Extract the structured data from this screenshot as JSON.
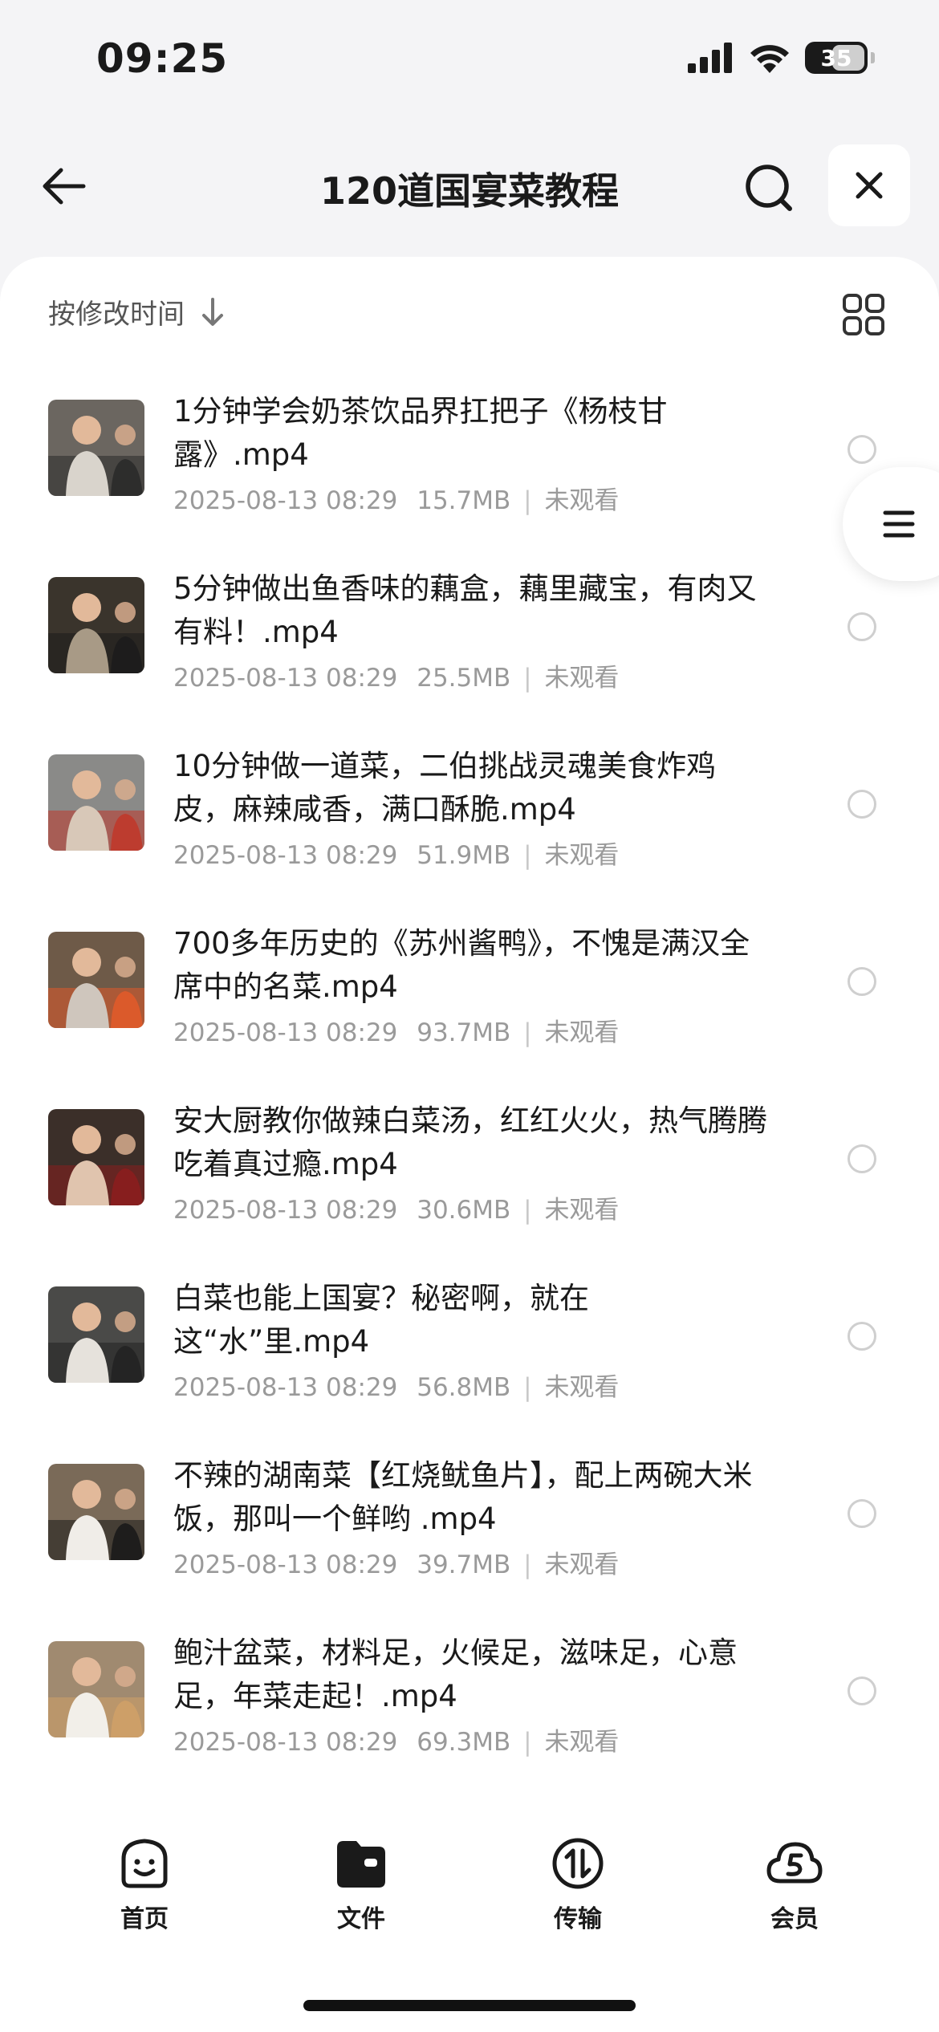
{
  "status_bar": {
    "time": "09:25",
    "battery": "35"
  },
  "nav": {
    "title": "120道国宴菜教程"
  },
  "sort": {
    "label": "按修改时间"
  },
  "files": [
    {
      "name": "1分钟学会奶茶饮品界扛把子《杨枝甘露》.mp4",
      "date": "2025-08-13 08:29",
      "size": "15.7MB",
      "status": "未观看",
      "thumb_colors": [
        "#6b6660",
        "#d9d4cc",
        "#2a2a2a"
      ]
    },
    {
      "name": "5分钟做出鱼香味的藕盒，藕里藏宝，有肉又有料！.mp4",
      "date": "2025-08-13 08:29",
      "size": "25.5MB",
      "status": "未观看",
      "thumb_colors": [
        "#3a342c",
        "#a89a86",
        "#1c1c1c"
      ]
    },
    {
      "name": "10分钟做一道菜，二伯挑战灵魂美食炸鸡皮，麻辣咸香，满口酥脆.mp4",
      "date": "2025-08-13 08:29",
      "size": "51.9MB",
      "status": "未观看",
      "thumb_colors": [
        "#8a8a88",
        "#d8c8b8",
        "#c0392b"
      ]
    },
    {
      "name": "700多年历史的《苏州酱鸭》，不愧是满汉全席中的名菜.mp4",
      "date": "2025-08-13 08:29",
      "size": "93.7MB",
      "status": "未观看",
      "thumb_colors": [
        "#6e5a48",
        "#cfc6bd",
        "#e05a2a"
      ]
    },
    {
      "name": "安大厨教你做辣白菜汤，红红火火，热气腾腾吃着真过瘾.mp4",
      "date": "2025-08-13 08:29",
      "size": "30.6MB",
      "status": "未观看",
      "thumb_colors": [
        "#3b2f29",
        "#e0c4ae",
        "#8b1e1e"
      ]
    },
    {
      "name": "白菜也能上国宴？秘密啊，就在这“水”里.mp4",
      "date": "2025-08-13 08:29",
      "size": "56.8MB",
      "status": "未观看",
      "thumb_colors": [
        "#4a4a48",
        "#e6e2dc",
        "#222"
      ]
    },
    {
      "name": "不辣的湖南菜【红烧鱿鱼片】，配上两碗大米饭，那叫一个鲜哟 .mp4",
      "date": "2025-08-13 08:29",
      "size": "39.7MB",
      "status": "未观看",
      "thumb_colors": [
        "#7a6a58",
        "#f0ede8",
        "#1a1a1a"
      ]
    },
    {
      "name": "鲍汁盆菜，材料足，火候足，滋味足，心意足，年菜走起！.mp4",
      "date": "2025-08-13 08:29",
      "size": "69.3MB",
      "status": "未观看",
      "thumb_colors": [
        "#a08a70",
        "#f2efe9",
        "#cfa068"
      ]
    }
  ],
  "tabs": [
    {
      "label": "首页",
      "icon": "home-face-icon"
    },
    {
      "label": "文件",
      "icon": "folder-icon"
    },
    {
      "label": "传输",
      "icon": "transfer-icon"
    },
    {
      "label": "会员",
      "icon": "vip-cloud-icon"
    }
  ]
}
